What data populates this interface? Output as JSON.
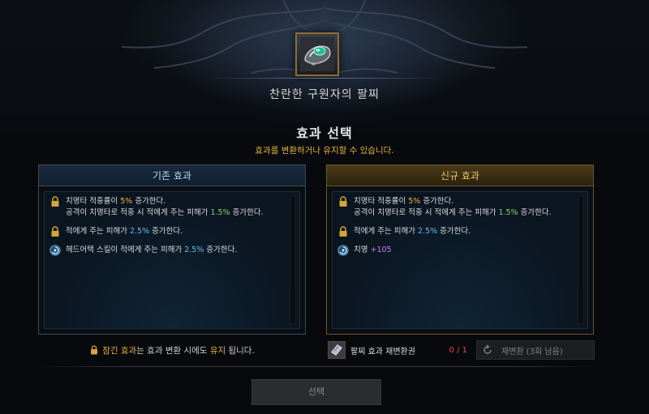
{
  "item": {
    "name": "찬란한 구원자의 팔찌"
  },
  "header": {
    "title": "효과 선택",
    "subtitle": "효과를 변환하거나 유지할 수 있습니다."
  },
  "panels": {
    "old": {
      "title": "기존 효과",
      "effects": [
        {
          "icon": "lock-icon",
          "lines": [
            {
              "pre": "치명타 적중률이 ",
              "val": "5%",
              "post": " 증가한다."
            },
            {
              "pre": "공격이 치명타로 적중 시 적에게 주는 피해가 ",
              "val": "1.5%",
              "post": " 증가한다."
            }
          ]
        },
        {
          "icon": "lock-icon",
          "lines": [
            {
              "pre": "적에게 주는 피해가 ",
              "val": "2.5%",
              "post": " 증가한다."
            }
          ]
        },
        {
          "icon": "swirl-effect-icon",
          "lines": [
            {
              "pre": "헤드어택 스킬이 적에게 주는 피해가 ",
              "val": "2.5%",
              "post": " 증가한다."
            }
          ]
        }
      ]
    },
    "new": {
      "title": "신규 효과",
      "effects": [
        {
          "icon": "lock-icon",
          "lines": [
            {
              "pre": "치명타 적중률이 ",
              "val": "5%",
              "post": " 증가한다."
            },
            {
              "pre": "공격이 치명타로 적중 시 적에게 주는 피해가 ",
              "val": "1.5%",
              "post": " 증가한다."
            }
          ]
        },
        {
          "icon": "lock-icon",
          "lines": [
            {
              "pre": "적에게 주는 피해가 ",
              "val": "2.5%",
              "post": " 증가한다."
            }
          ]
        },
        {
          "icon": "swirl-effect-icon",
          "lines": [
            {
              "pre": "치명 ",
              "val": "+105",
              "post": ""
            }
          ]
        }
      ]
    }
  },
  "footer": {
    "lock_note": {
      "gold1": "잠긴 효과",
      "mid": "는 효과 변환 시에도 ",
      "gold2": "유지",
      "post": " 됩니다."
    },
    "ticket": {
      "label": "팔찌 효과 재변환권",
      "count": "0 / 1"
    },
    "reroll_button": "재변환 (3회 남음)",
    "select_button": "선택"
  },
  "colors": {
    "gold": "#e7b53e",
    "green": "#8ed27a",
    "blue": "#6bb9e6",
    "purple": "#c77ff0",
    "red": "#e24a3a"
  }
}
